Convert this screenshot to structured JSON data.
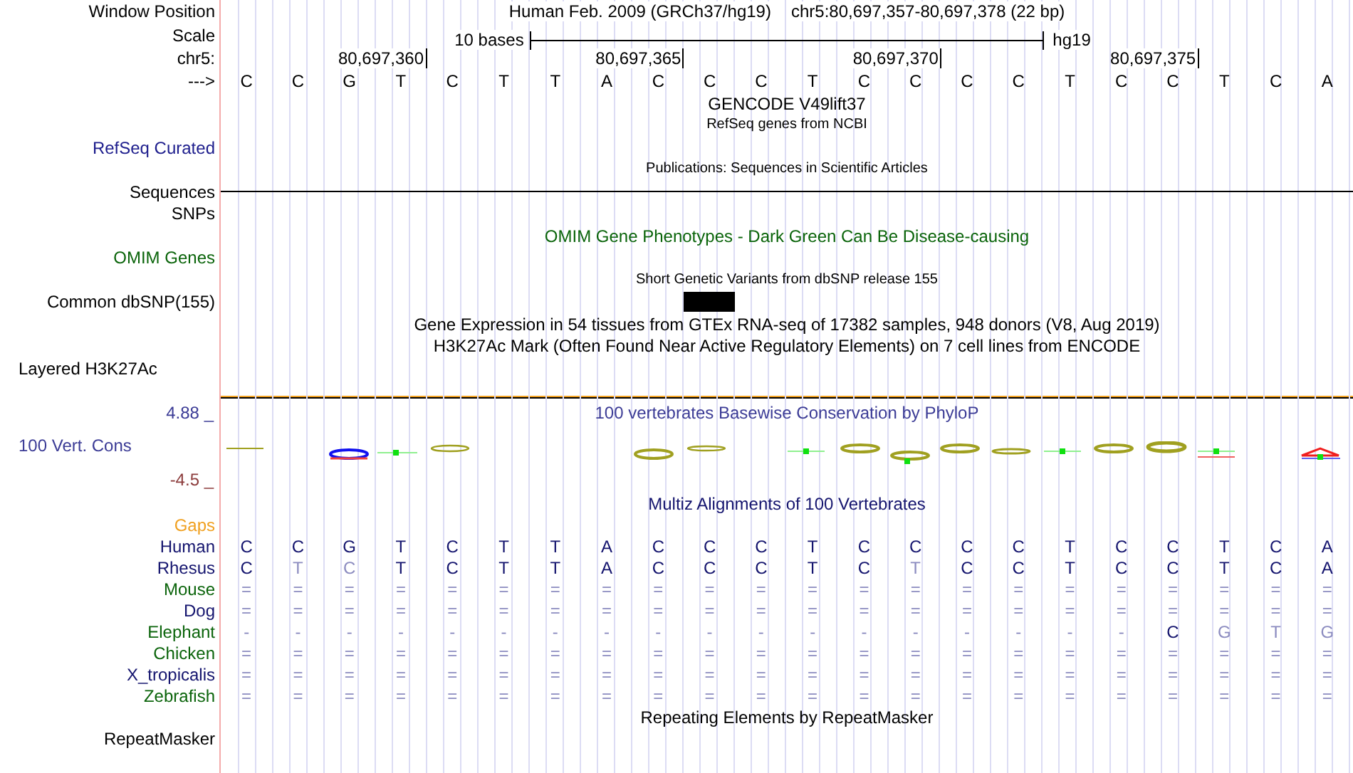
{
  "header": {
    "position_label": "Window Position",
    "assembly": "Human Feb. 2009 (GRCh37/hg19)",
    "range": "chr5:80,697,357-80,697,378 (22 bp)",
    "scale_label": "Scale",
    "scale_text": "10 bases",
    "scale_db": "hg19",
    "chrom_label": "chr5:",
    "ticks": [
      "80,697,360",
      "80,697,365",
      "80,697,370",
      "80,697,375"
    ],
    "strand_label": "--->",
    "bases": [
      "C",
      "C",
      "G",
      "T",
      "C",
      "T",
      "T",
      "A",
      "C",
      "C",
      "C",
      "T",
      "C",
      "C",
      "C",
      "C",
      "T",
      "C",
      "C",
      "T",
      "C",
      "A"
    ]
  },
  "tracks": [
    {
      "kind": "title",
      "text": "GENCODE V49lift37",
      "color": "#000000"
    },
    {
      "kind": "subtitle",
      "text": "RefSeq genes from NCBI",
      "color": "#000000"
    },
    {
      "kind": "label",
      "text": "RefSeq Curated",
      "color": "#1c1c8c"
    },
    {
      "kind": "subtitle",
      "text": "Publications: Sequences in Scientific Articles",
      "color": "#000000"
    },
    {
      "kind": "label_rule",
      "text": "Sequences",
      "color": "#000000"
    },
    {
      "kind": "label",
      "text": "SNPs",
      "color": "#000000"
    },
    {
      "kind": "title",
      "text": "OMIM Gene Phenotypes - Dark Green Can Be Disease-causing",
      "color": "#0a640a"
    },
    {
      "kind": "label",
      "text": "OMIM Genes",
      "color": "#0a640a"
    },
    {
      "kind": "subtitle",
      "text": "Short Genetic Variants from dbSNP release 155",
      "color": "#000000"
    },
    {
      "kind": "label_feature",
      "text": "Common dbSNP(155)",
      "color": "#000000"
    },
    {
      "kind": "title",
      "text": "Gene Expression in 54 tissues from GTEx RNA-seq of 17382 samples, 948 donors (V8, Aug 2019)",
      "color": "#000000"
    },
    {
      "kind": "title",
      "text": "H3K27Ac Mark (Often Found Near Active Regulatory Elements) on 7 cell lines from ENCODE",
      "color": "#000000"
    },
    {
      "kind": "label_left",
      "text": "Layered H3K27Ac",
      "color": "#000000"
    }
  ],
  "conservation": {
    "max": "4.88 _",
    "label": "100 Vert. Cons",
    "min": "-4.5 _",
    "title": "100 vertebrates Basewise Conservation by PhyloP"
  },
  "alignment": {
    "title": "Multiz Alignments of 100 Vertebrates",
    "gaps_label": "Gaps",
    "species": [
      {
        "name": "Human",
        "color": "#14146e",
        "bases": [
          {
            "text": "C",
            "faded": false
          },
          {
            "text": "C",
            "faded": false
          },
          {
            "text": "G",
            "faded": false
          },
          {
            "text": "T",
            "faded": false
          },
          {
            "text": "C",
            "faded": false
          },
          {
            "text": "T",
            "faded": false
          },
          {
            "text": "T",
            "faded": false
          },
          {
            "text": "A",
            "faded": false
          },
          {
            "text": "C",
            "faded": false
          },
          {
            "text": "C",
            "faded": false
          },
          {
            "text": "C",
            "faded": false
          },
          {
            "text": "T",
            "faded": false
          },
          {
            "text": "C",
            "faded": false
          },
          {
            "text": "C",
            "faded": false
          },
          {
            "text": "C",
            "faded": false
          },
          {
            "text": "C",
            "faded": false
          },
          {
            "text": "T",
            "faded": false
          },
          {
            "text": "C",
            "faded": false
          },
          {
            "text": "C",
            "faded": false
          },
          {
            "text": "T",
            "faded": false
          },
          {
            "text": "C",
            "faded": false
          },
          {
            "text": "A",
            "faded": false
          }
        ]
      },
      {
        "name": "Rhesus",
        "color": "#14146e",
        "bases": [
          {
            "text": "C",
            "faded": false
          },
          {
            "text": "T",
            "faded": true
          },
          {
            "text": "C",
            "faded": true
          },
          {
            "text": "T",
            "faded": false
          },
          {
            "text": "C",
            "faded": false
          },
          {
            "text": "T",
            "faded": false
          },
          {
            "text": "T",
            "faded": false
          },
          {
            "text": "A",
            "faded": false
          },
          {
            "text": "C",
            "faded": false
          },
          {
            "text": "C",
            "faded": false
          },
          {
            "text": "C",
            "faded": false
          },
          {
            "text": "T",
            "faded": false
          },
          {
            "text": "C",
            "faded": false
          },
          {
            "text": "T",
            "faded": true
          },
          {
            "text": "C",
            "faded": false
          },
          {
            "text": "C",
            "faded": false
          },
          {
            "text": "T",
            "faded": false
          },
          {
            "text": "C",
            "faded": false
          },
          {
            "text": "C",
            "faded": false
          },
          {
            "text": "T",
            "faded": false
          },
          {
            "text": "C",
            "faded": false
          },
          {
            "text": "A",
            "faded": false
          }
        ]
      },
      {
        "name": "Mouse",
        "color": "#0b640b",
        "bases": [
          {
            "text": "=",
            "faded": true
          },
          {
            "text": "=",
            "faded": true
          },
          {
            "text": "=",
            "faded": true
          },
          {
            "text": "=",
            "faded": true
          },
          {
            "text": "=",
            "faded": true
          },
          {
            "text": "=",
            "faded": true
          },
          {
            "text": "=",
            "faded": true
          },
          {
            "text": "=",
            "faded": true
          },
          {
            "text": "=",
            "faded": true
          },
          {
            "text": "=",
            "faded": true
          },
          {
            "text": "=",
            "faded": true
          },
          {
            "text": "=",
            "faded": true
          },
          {
            "text": "=",
            "faded": true
          },
          {
            "text": "=",
            "faded": true
          },
          {
            "text": "=",
            "faded": true
          },
          {
            "text": "=",
            "faded": true
          },
          {
            "text": "=",
            "faded": true
          },
          {
            "text": "=",
            "faded": true
          },
          {
            "text": "=",
            "faded": true
          },
          {
            "text": "=",
            "faded": true
          },
          {
            "text": "=",
            "faded": true
          },
          {
            "text": "=",
            "faded": true
          }
        ]
      },
      {
        "name": "Dog",
        "color": "#14146e",
        "bases": [
          {
            "text": "=",
            "faded": true
          },
          {
            "text": "=",
            "faded": true
          },
          {
            "text": "=",
            "faded": true
          },
          {
            "text": "=",
            "faded": true
          },
          {
            "text": "=",
            "faded": true
          },
          {
            "text": "=",
            "faded": true
          },
          {
            "text": "=",
            "faded": true
          },
          {
            "text": "=",
            "faded": true
          },
          {
            "text": "=",
            "faded": true
          },
          {
            "text": "=",
            "faded": true
          },
          {
            "text": "=",
            "faded": true
          },
          {
            "text": "=",
            "faded": true
          },
          {
            "text": "=",
            "faded": true
          },
          {
            "text": "=",
            "faded": true
          },
          {
            "text": "=",
            "faded": true
          },
          {
            "text": "=",
            "faded": true
          },
          {
            "text": "=",
            "faded": true
          },
          {
            "text": "=",
            "faded": true
          },
          {
            "text": "=",
            "faded": true
          },
          {
            "text": "=",
            "faded": true
          },
          {
            "text": "=",
            "faded": true
          },
          {
            "text": "=",
            "faded": true
          }
        ]
      },
      {
        "name": "Elephant",
        "color": "#0b640b",
        "bases": [
          {
            "text": "-",
            "faded": true
          },
          {
            "text": "-",
            "faded": true
          },
          {
            "text": "-",
            "faded": true
          },
          {
            "text": "-",
            "faded": true
          },
          {
            "text": "-",
            "faded": true
          },
          {
            "text": "-",
            "faded": true
          },
          {
            "text": "-",
            "faded": true
          },
          {
            "text": "-",
            "faded": true
          },
          {
            "text": "-",
            "faded": true
          },
          {
            "text": "-",
            "faded": true
          },
          {
            "text": "-",
            "faded": true
          },
          {
            "text": "-",
            "faded": true
          },
          {
            "text": "-",
            "faded": true
          },
          {
            "text": "-",
            "faded": true
          },
          {
            "text": "-",
            "faded": true
          },
          {
            "text": "-",
            "faded": true
          },
          {
            "text": "-",
            "faded": true
          },
          {
            "text": "-",
            "faded": true
          },
          {
            "text": "C",
            "faded": false
          },
          {
            "text": "G",
            "faded": true
          },
          {
            "text": "T",
            "faded": true
          },
          {
            "text": "G",
            "faded": true
          }
        ]
      },
      {
        "name": "Chicken",
        "color": "#0b640b",
        "bases": [
          {
            "text": "=",
            "faded": true
          },
          {
            "text": "=",
            "faded": true
          },
          {
            "text": "=",
            "faded": true
          },
          {
            "text": "=",
            "faded": true
          },
          {
            "text": "=",
            "faded": true
          },
          {
            "text": "=",
            "faded": true
          },
          {
            "text": "=",
            "faded": true
          },
          {
            "text": "=",
            "faded": true
          },
          {
            "text": "=",
            "faded": true
          },
          {
            "text": "=",
            "faded": true
          },
          {
            "text": "=",
            "faded": true
          },
          {
            "text": "=",
            "faded": true
          },
          {
            "text": "=",
            "faded": true
          },
          {
            "text": "=",
            "faded": true
          },
          {
            "text": "=",
            "faded": true
          },
          {
            "text": "=",
            "faded": true
          },
          {
            "text": "=",
            "faded": true
          },
          {
            "text": "=",
            "faded": true
          },
          {
            "text": "=",
            "faded": true
          },
          {
            "text": "=",
            "faded": true
          },
          {
            "text": "=",
            "faded": true
          },
          {
            "text": "=",
            "faded": true
          }
        ]
      },
      {
        "name": "X_tropicalis",
        "color": "#14146e",
        "bases": [
          {
            "text": "=",
            "faded": true
          },
          {
            "text": "=",
            "faded": true
          },
          {
            "text": "=",
            "faded": true
          },
          {
            "text": "=",
            "faded": true
          },
          {
            "text": "=",
            "faded": true
          },
          {
            "text": "=",
            "faded": true
          },
          {
            "text": "=",
            "faded": true
          },
          {
            "text": "=",
            "faded": true
          },
          {
            "text": "=",
            "faded": true
          },
          {
            "text": "=",
            "faded": true
          },
          {
            "text": "=",
            "faded": true
          },
          {
            "text": "=",
            "faded": true
          },
          {
            "text": "=",
            "faded": true
          },
          {
            "text": "=",
            "faded": true
          },
          {
            "text": "=",
            "faded": true
          },
          {
            "text": "=",
            "faded": true
          },
          {
            "text": "=",
            "faded": true
          },
          {
            "text": "=",
            "faded": true
          },
          {
            "text": "=",
            "faded": true
          },
          {
            "text": "=",
            "faded": true
          },
          {
            "text": "=",
            "faded": true
          },
          {
            "text": "=",
            "faded": true
          }
        ]
      },
      {
        "name": "Zebrafish",
        "color": "#0b640b",
        "bases": [
          {
            "text": "=",
            "faded": true
          },
          {
            "text": "=",
            "faded": true
          },
          {
            "text": "=",
            "faded": true
          },
          {
            "text": "=",
            "faded": true
          },
          {
            "text": "=",
            "faded": true
          },
          {
            "text": "=",
            "faded": true
          },
          {
            "text": "=",
            "faded": true
          },
          {
            "text": "=",
            "faded": true
          },
          {
            "text": "=",
            "faded": true
          },
          {
            "text": "=",
            "faded": true
          },
          {
            "text": "=",
            "faded": true
          },
          {
            "text": "=",
            "faded": true
          },
          {
            "text": "=",
            "faded": true
          },
          {
            "text": "=",
            "faded": true
          },
          {
            "text": "=",
            "faded": true
          },
          {
            "text": "=",
            "faded": true
          },
          {
            "text": "=",
            "faded": true
          },
          {
            "text": "=",
            "faded": true
          },
          {
            "text": "=",
            "faded": true
          },
          {
            "text": "=",
            "faded": true
          },
          {
            "text": "=",
            "faded": true
          },
          {
            "text": "=",
            "faded": true
          }
        ]
      }
    ]
  },
  "repeats": {
    "title": "Repeating Elements by RepeatMasker",
    "label": "RepeatMasker"
  }
}
